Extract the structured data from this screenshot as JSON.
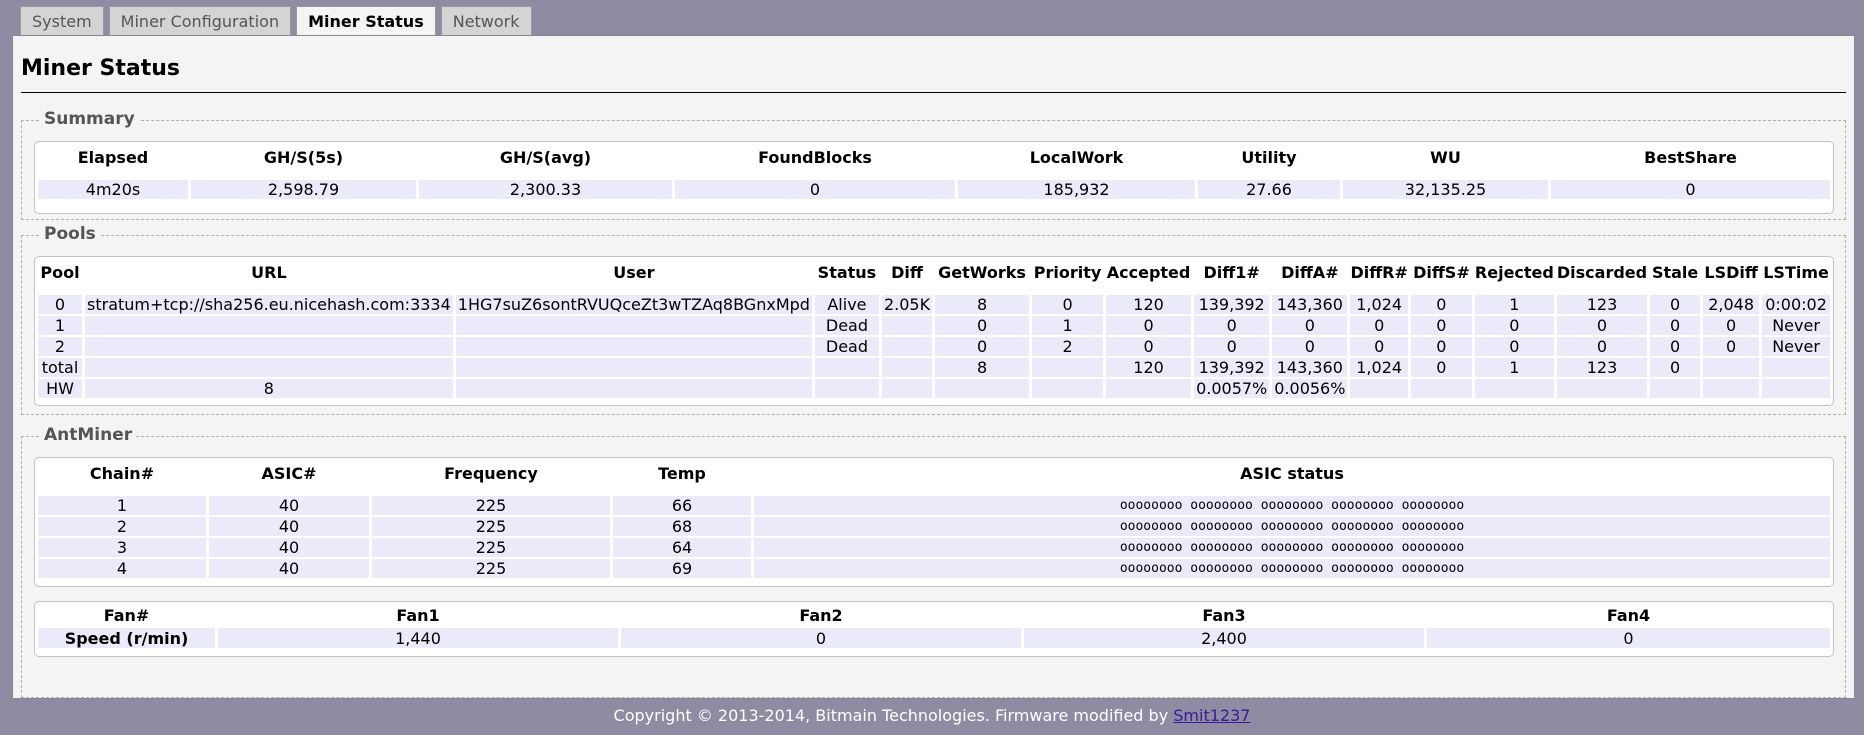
{
  "tabs": [
    {
      "label": "System",
      "active": false
    },
    {
      "label": "Miner Configuration",
      "active": false
    },
    {
      "label": "Miner Status",
      "active": true
    },
    {
      "label": "Network",
      "active": false
    }
  ],
  "page_title": "Miner Status",
  "summary": {
    "legend": "Summary",
    "headers": [
      "Elapsed",
      "GH/S(5s)",
      "GH/S(avg)",
      "FoundBlocks",
      "LocalWork",
      "Utility",
      "WU",
      "BestShare"
    ],
    "values": [
      "4m20s",
      "2,598.79",
      "2,300.33",
      "0",
      "185,932",
      "27.66",
      "32,135.25",
      "0"
    ]
  },
  "pools": {
    "legend": "Pools",
    "headers": [
      "Pool",
      "URL",
      "User",
      "Status",
      "Diff",
      "GetWorks",
      "Priority",
      "Accepted",
      "Diff1#",
      "DiffA#",
      "DiffR#",
      "DiffS#",
      "Rejected",
      "Discarded",
      "Stale",
      "LSDiff",
      "LSTime"
    ],
    "rows": [
      [
        "0",
        "stratum+tcp://sha256.eu.nicehash.com:3334",
        "1HG7suZ6sontRVUQceZt3wTZAq8BGnxMpd",
        "Alive",
        "2.05K",
        "8",
        "0",
        "120",
        "139,392",
        "143,360",
        "1,024",
        "0",
        "1",
        "123",
        "0",
        "2,048",
        "0:00:02"
      ],
      [
        "1",
        "",
        "",
        "Dead",
        "",
        "0",
        "1",
        "0",
        "0",
        "0",
        "0",
        "0",
        "0",
        "0",
        "0",
        "0",
        "Never"
      ],
      [
        "2",
        "",
        "",
        "Dead",
        "",
        "0",
        "2",
        "0",
        "0",
        "0",
        "0",
        "0",
        "0",
        "0",
        "0",
        "0",
        "Never"
      ],
      [
        "total",
        "",
        "",
        "",
        "",
        "8",
        "",
        "120",
        "139,392",
        "143,360",
        "1,024",
        "0",
        "1",
        "123",
        "0",
        "",
        ""
      ],
      [
        "HW",
        "8",
        "",
        "",
        "",
        "",
        "",
        "",
        "0.0057%",
        "0.0056%",
        "",
        "",
        "",
        "",
        "",
        "",
        ""
      ]
    ]
  },
  "antminer": {
    "legend": "AntMiner",
    "chain_headers": [
      "Chain#",
      "ASIC#",
      "Frequency",
      "Temp",
      "ASIC status"
    ],
    "chains": [
      [
        "1",
        "40",
        "225",
        "66",
        "oooooooo oooooooo oooooooo oooooooo oooooooo"
      ],
      [
        "2",
        "40",
        "225",
        "68",
        "oooooooo oooooooo oooooooo oooooooo oooooooo"
      ],
      [
        "3",
        "40",
        "225",
        "64",
        "oooooooo oooooooo oooooooo oooooooo oooooooo"
      ],
      [
        "4",
        "40",
        "225",
        "69",
        "oooooooo oooooooo oooooooo oooooooo oooooooo"
      ]
    ],
    "fan_headers": [
      "Fan#",
      "Fan1",
      "Fan2",
      "Fan3",
      "Fan4"
    ],
    "fan_row_label": "Speed (r/min)",
    "fan_speeds": [
      "1,440",
      "0",
      "2,400",
      "0"
    ]
  },
  "footer": {
    "text": "Copyright © 2013-2014, Bitmain Technologies. Firmware modified by ",
    "link": "Smit1237"
  }
}
